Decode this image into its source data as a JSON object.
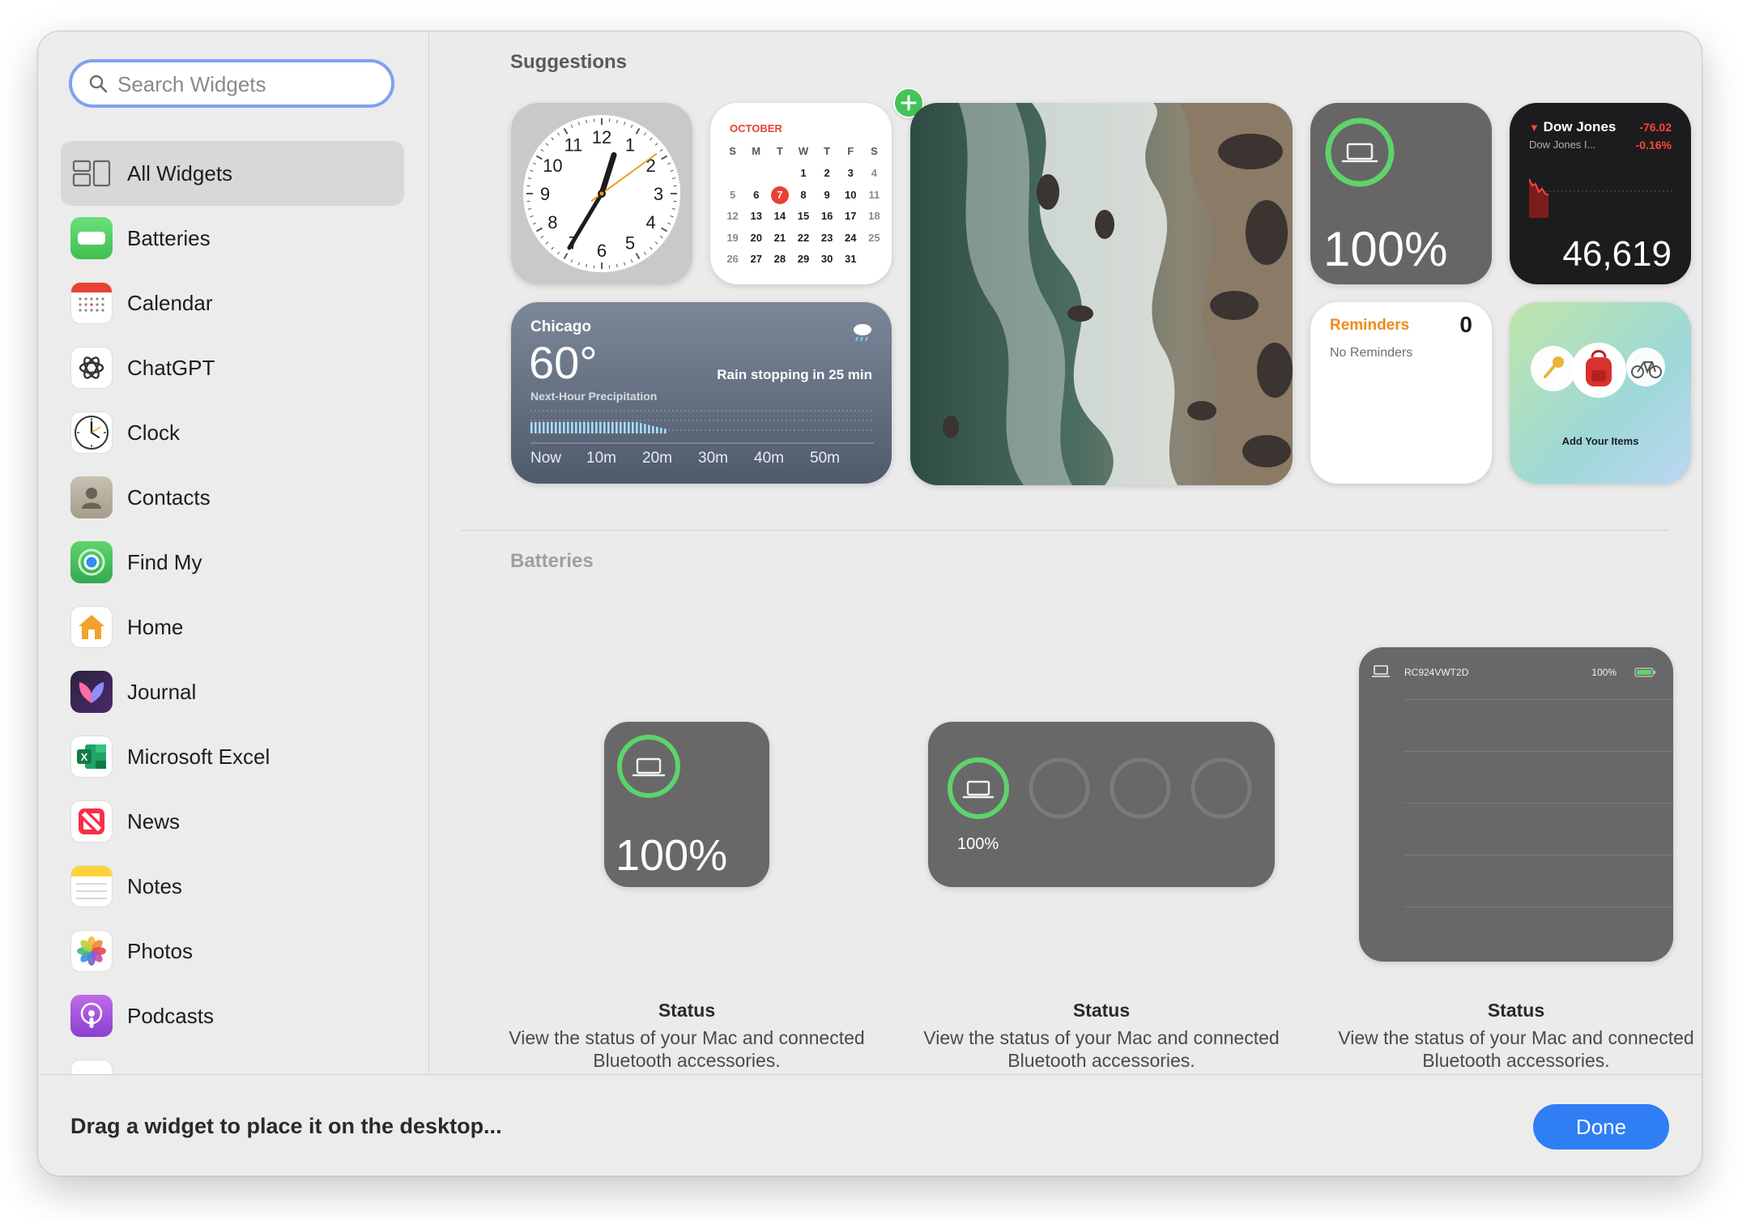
{
  "search": {
    "placeholder": "Search Widgets"
  },
  "sidebar": {
    "items": [
      {
        "label": "All Widgets",
        "icon": "all-widgets-icon",
        "selected": true
      },
      {
        "label": "Batteries",
        "icon": "batteries-icon"
      },
      {
        "label": "Calendar",
        "icon": "calendar-icon"
      },
      {
        "label": "ChatGPT",
        "icon": "chatgpt-icon"
      },
      {
        "label": "Clock",
        "icon": "clock-icon"
      },
      {
        "label": "Contacts",
        "icon": "contacts-icon"
      },
      {
        "label": "Find My",
        "icon": "find-my-icon"
      },
      {
        "label": "Home",
        "icon": "home-icon"
      },
      {
        "label": "Journal",
        "icon": "journal-icon"
      },
      {
        "label": "Microsoft Excel",
        "icon": "excel-icon"
      },
      {
        "label": "News",
        "icon": "news-icon"
      },
      {
        "label": "Notes",
        "icon": "notes-icon"
      },
      {
        "label": "Photos",
        "icon": "photos-icon"
      },
      {
        "label": "Podcasts",
        "icon": "podcasts-icon"
      }
    ]
  },
  "main": {
    "suggestions_title": "Suggestions",
    "batteries_title": "Batteries"
  },
  "clock": {
    "numbers": [
      "12",
      "1",
      "2",
      "3",
      "4",
      "5",
      "6",
      "7",
      "8",
      "9",
      "10",
      "11"
    ],
    "hour": 12,
    "minute": 35,
    "second": 9
  },
  "calendar": {
    "month": "OCTOBER",
    "weekdays": [
      "S",
      "M",
      "T",
      "W",
      "T",
      "F",
      "S"
    ],
    "today": "7",
    "weeks": [
      [
        "",
        "",
        "",
        "1",
        "2",
        "3",
        "4"
      ],
      [
        "5",
        "6",
        "7",
        "8",
        "9",
        "10",
        "11"
      ],
      [
        "12",
        "13",
        "14",
        "15",
        "16",
        "17",
        "18"
      ],
      [
        "19",
        "20",
        "21",
        "22",
        "23",
        "24",
        "25"
      ],
      [
        "26",
        "27",
        "28",
        "29",
        "30",
        "31",
        ""
      ]
    ]
  },
  "weather": {
    "city": "Chicago",
    "temp": "60°",
    "summary": "Rain stopping in 25 min",
    "subtitle": "Next-Hour Precipitation",
    "ticks": [
      "Now",
      "10m",
      "20m",
      "30m",
      "40m",
      "50m"
    ]
  },
  "battery_small": {
    "percent": "100%"
  },
  "stocks": {
    "name": "Dow Jones",
    "subname": "Dow Jones I...",
    "change": "-76.02",
    "change_pct": "-0.16%",
    "value": "46,619"
  },
  "reminders": {
    "title": "Reminders",
    "count": "0",
    "empty": "No Reminders"
  },
  "findmy": {
    "caption": "Add Your Items"
  },
  "battery_cards": [
    {
      "percent": "100%",
      "title": "Status",
      "desc": "View the status of your Mac and connected Bluetooth accessories."
    },
    {
      "percent": "100%",
      "title": "Status",
      "desc": "View the status of your Mac and connected Bluetooth accessories."
    },
    {
      "device": "RC924VWT2D",
      "percent": "100%",
      "title": "Status",
      "desc": "View the status of your Mac and connected Bluetooth accessories."
    }
  ],
  "footer": {
    "message": "Drag a widget to place it on the desktop...",
    "done_label": "Done"
  },
  "colors": {
    "accent": "#2f7ef4",
    "battery_green": "#5ed36a",
    "calendar_red": "#e84035",
    "reminders_orange": "#f08a1c",
    "stocks_red": "#ff453a"
  }
}
